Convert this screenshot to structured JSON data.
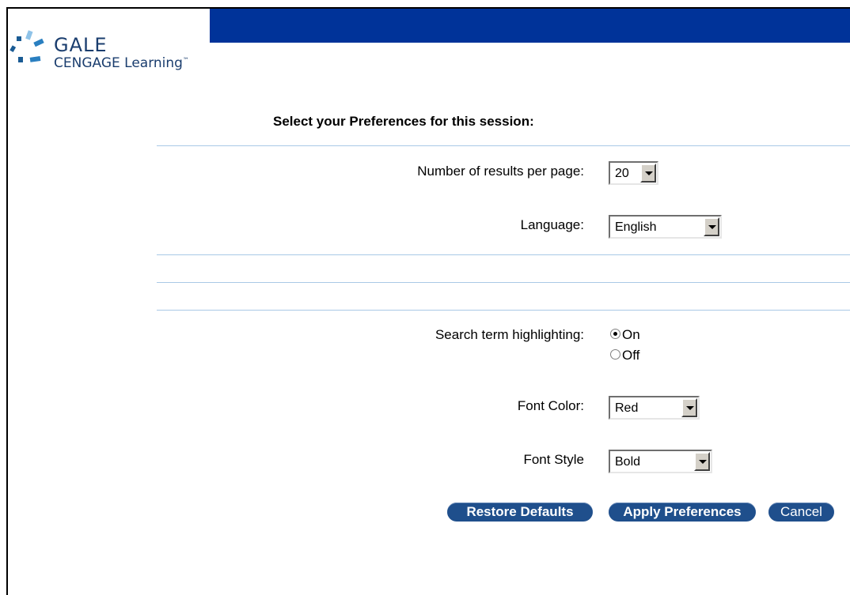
{
  "brand": {
    "name_top": "GALE",
    "name_bottom": "CENGAGE Learning",
    "tm": "™"
  },
  "heading": "Select your Preferences for this session:",
  "results": {
    "label": "Number of results per page:",
    "value": "20"
  },
  "language": {
    "label": "Language:",
    "value": "English"
  },
  "highlighting": {
    "label": "Search term highlighting:",
    "on_label": "On",
    "off_label": "Off",
    "selected": "On"
  },
  "font_color": {
    "label": "Font Color:",
    "value": "Red"
  },
  "font_style": {
    "label": "Font Style",
    "value": "Bold"
  },
  "buttons": {
    "restore": "Restore Defaults",
    "apply": "Apply Preferences",
    "cancel": "Cancel"
  },
  "colors": {
    "banner": "#003399",
    "button": "#1f4f8c",
    "rule": "#a9c9e6"
  }
}
